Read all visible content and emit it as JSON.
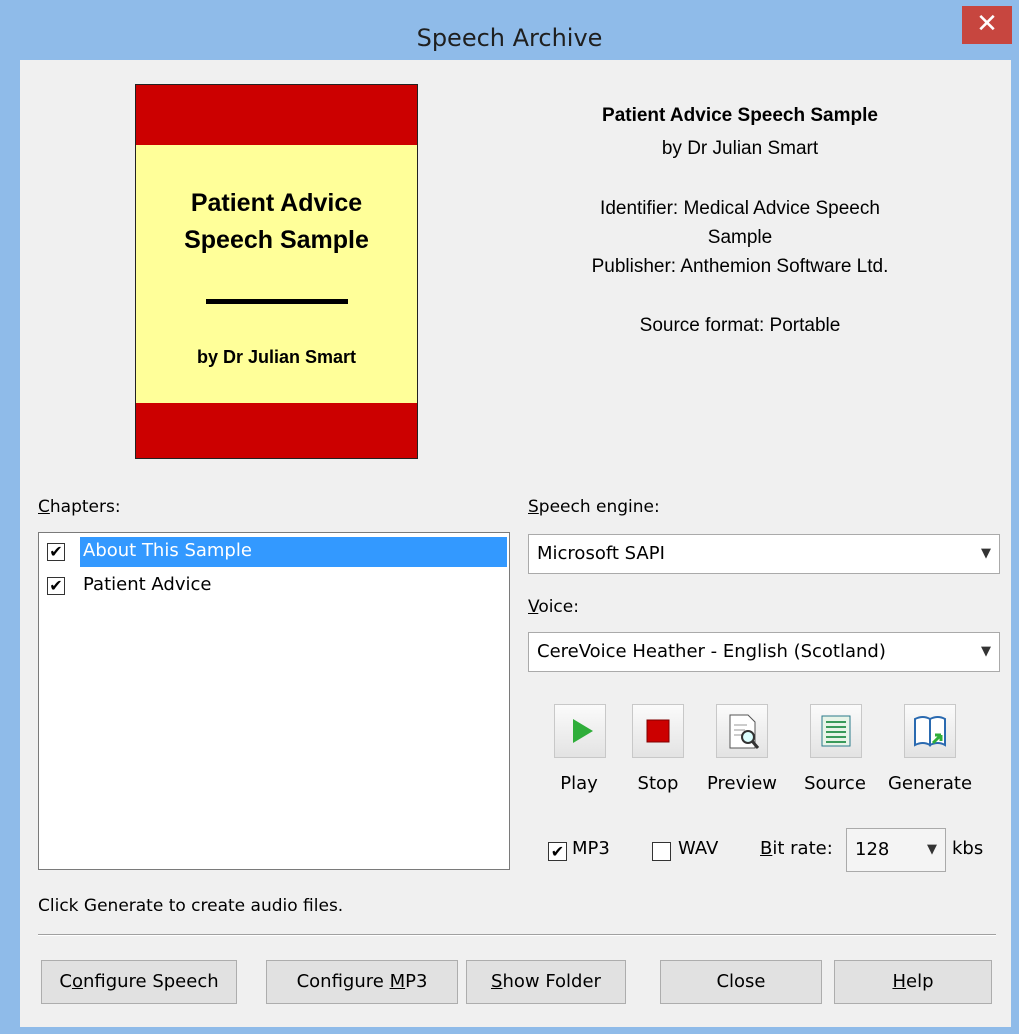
{
  "window": {
    "title": "Speech Archive",
    "close_glyph": "✕"
  },
  "cover": {
    "title_line1": "Patient Advice",
    "title_line2": "Speech Sample",
    "author": "by Dr Julian Smart",
    "colors": {
      "band": "#cc0000",
      "page": "#ffff99"
    }
  },
  "info": {
    "title": "Patient Advice Speech Sample",
    "author": "by Dr Julian Smart",
    "identifier_line1": "Identifier: Medical Advice Speech",
    "identifier_line2": "Sample",
    "publisher": "Publisher: Anthemion Software Ltd.",
    "source_format": "Source format: Portable"
  },
  "chapters": {
    "label_accel": "C",
    "label_rest": "hapters:",
    "items": [
      {
        "label": "About This Sample",
        "checked": true,
        "selected": true
      },
      {
        "label": "Patient Advice",
        "checked": true,
        "selected": false
      }
    ]
  },
  "speech_engine": {
    "label_accel": "S",
    "label_rest": "peech engine:",
    "value": "Microsoft SAPI"
  },
  "voice": {
    "label_accel": "V",
    "label_rest": "oice:",
    "value": "CereVoice Heather - English (Scotland)"
  },
  "toolbar": {
    "play": "Play",
    "stop": "Stop",
    "preview": "Preview",
    "source": "Source",
    "generate": "Generate"
  },
  "output": {
    "mp3_label": "MP3",
    "mp3_checked": true,
    "wav_label": "WAV",
    "wav_checked": false,
    "bitrate_label_accel": "B",
    "bitrate_label_rest": "it rate:",
    "bitrate_value": "128",
    "bitrate_unit": "kbs"
  },
  "status": "Click Generate to create audio files.",
  "buttons": {
    "configure_speech_pre": "C",
    "configure_speech_accel": "o",
    "configure_speech_post": "nfigure Speech",
    "configure_mp3_pre": "Configure ",
    "configure_mp3_accel": "M",
    "configure_mp3_post": "P3",
    "show_folder_pre": "",
    "show_folder_accel": "S",
    "show_folder_post": "how Folder",
    "close": "Close",
    "help_accel": "H",
    "help_post": "elp"
  },
  "icons": {
    "play": "play-icon",
    "stop": "stop-icon",
    "preview": "preview-icon",
    "source": "source-icon",
    "generate": "generate-icon"
  }
}
